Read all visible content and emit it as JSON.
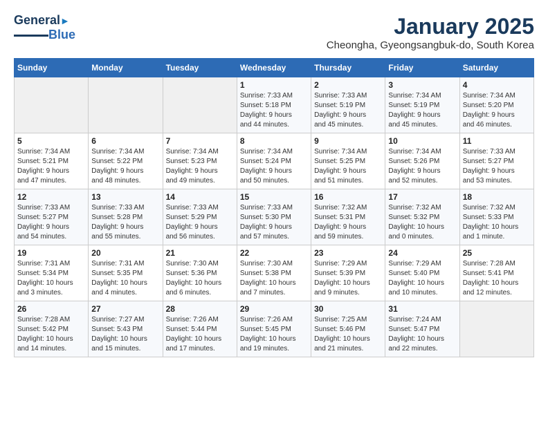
{
  "logo": {
    "line1": "General",
    "line2": "Blue"
  },
  "title": "January 2025",
  "subtitle": "Cheongha, Gyeongsangbuk-do, South Korea",
  "headers": [
    "Sunday",
    "Monday",
    "Tuesday",
    "Wednesday",
    "Thursday",
    "Friday",
    "Saturday"
  ],
  "weeks": [
    [
      {
        "day": "",
        "info": ""
      },
      {
        "day": "",
        "info": ""
      },
      {
        "day": "",
        "info": ""
      },
      {
        "day": "1",
        "info": "Sunrise: 7:33 AM\nSunset: 5:18 PM\nDaylight: 9 hours\nand 44 minutes."
      },
      {
        "day": "2",
        "info": "Sunrise: 7:33 AM\nSunset: 5:19 PM\nDaylight: 9 hours\nand 45 minutes."
      },
      {
        "day": "3",
        "info": "Sunrise: 7:34 AM\nSunset: 5:19 PM\nDaylight: 9 hours\nand 45 minutes."
      },
      {
        "day": "4",
        "info": "Sunrise: 7:34 AM\nSunset: 5:20 PM\nDaylight: 9 hours\nand 46 minutes."
      }
    ],
    [
      {
        "day": "5",
        "info": "Sunrise: 7:34 AM\nSunset: 5:21 PM\nDaylight: 9 hours\nand 47 minutes."
      },
      {
        "day": "6",
        "info": "Sunrise: 7:34 AM\nSunset: 5:22 PM\nDaylight: 9 hours\nand 48 minutes."
      },
      {
        "day": "7",
        "info": "Sunrise: 7:34 AM\nSunset: 5:23 PM\nDaylight: 9 hours\nand 49 minutes."
      },
      {
        "day": "8",
        "info": "Sunrise: 7:34 AM\nSunset: 5:24 PM\nDaylight: 9 hours\nand 50 minutes."
      },
      {
        "day": "9",
        "info": "Sunrise: 7:34 AM\nSunset: 5:25 PM\nDaylight: 9 hours\nand 51 minutes."
      },
      {
        "day": "10",
        "info": "Sunrise: 7:34 AM\nSunset: 5:26 PM\nDaylight: 9 hours\nand 52 minutes."
      },
      {
        "day": "11",
        "info": "Sunrise: 7:33 AM\nSunset: 5:27 PM\nDaylight: 9 hours\nand 53 minutes."
      }
    ],
    [
      {
        "day": "12",
        "info": "Sunrise: 7:33 AM\nSunset: 5:27 PM\nDaylight: 9 hours\nand 54 minutes."
      },
      {
        "day": "13",
        "info": "Sunrise: 7:33 AM\nSunset: 5:28 PM\nDaylight: 9 hours\nand 55 minutes."
      },
      {
        "day": "14",
        "info": "Sunrise: 7:33 AM\nSunset: 5:29 PM\nDaylight: 9 hours\nand 56 minutes."
      },
      {
        "day": "15",
        "info": "Sunrise: 7:33 AM\nSunset: 5:30 PM\nDaylight: 9 hours\nand 57 minutes."
      },
      {
        "day": "16",
        "info": "Sunrise: 7:32 AM\nSunset: 5:31 PM\nDaylight: 9 hours\nand 59 minutes."
      },
      {
        "day": "17",
        "info": "Sunrise: 7:32 AM\nSunset: 5:32 PM\nDaylight: 10 hours\nand 0 minutes."
      },
      {
        "day": "18",
        "info": "Sunrise: 7:32 AM\nSunset: 5:33 PM\nDaylight: 10 hours\nand 1 minute."
      }
    ],
    [
      {
        "day": "19",
        "info": "Sunrise: 7:31 AM\nSunset: 5:34 PM\nDaylight: 10 hours\nand 3 minutes."
      },
      {
        "day": "20",
        "info": "Sunrise: 7:31 AM\nSunset: 5:35 PM\nDaylight: 10 hours\nand 4 minutes."
      },
      {
        "day": "21",
        "info": "Sunrise: 7:30 AM\nSunset: 5:36 PM\nDaylight: 10 hours\nand 6 minutes."
      },
      {
        "day": "22",
        "info": "Sunrise: 7:30 AM\nSunset: 5:38 PM\nDaylight: 10 hours\nand 7 minutes."
      },
      {
        "day": "23",
        "info": "Sunrise: 7:29 AM\nSunset: 5:39 PM\nDaylight: 10 hours\nand 9 minutes."
      },
      {
        "day": "24",
        "info": "Sunrise: 7:29 AM\nSunset: 5:40 PM\nDaylight: 10 hours\nand 10 minutes."
      },
      {
        "day": "25",
        "info": "Sunrise: 7:28 AM\nSunset: 5:41 PM\nDaylight: 10 hours\nand 12 minutes."
      }
    ],
    [
      {
        "day": "26",
        "info": "Sunrise: 7:28 AM\nSunset: 5:42 PM\nDaylight: 10 hours\nand 14 minutes."
      },
      {
        "day": "27",
        "info": "Sunrise: 7:27 AM\nSunset: 5:43 PM\nDaylight: 10 hours\nand 15 minutes."
      },
      {
        "day": "28",
        "info": "Sunrise: 7:26 AM\nSunset: 5:44 PM\nDaylight: 10 hours\nand 17 minutes."
      },
      {
        "day": "29",
        "info": "Sunrise: 7:26 AM\nSunset: 5:45 PM\nDaylight: 10 hours\nand 19 minutes."
      },
      {
        "day": "30",
        "info": "Sunrise: 7:25 AM\nSunset: 5:46 PM\nDaylight: 10 hours\nand 21 minutes."
      },
      {
        "day": "31",
        "info": "Sunrise: 7:24 AM\nSunset: 5:47 PM\nDaylight: 10 hours\nand 22 minutes."
      },
      {
        "day": "",
        "info": ""
      }
    ]
  ]
}
